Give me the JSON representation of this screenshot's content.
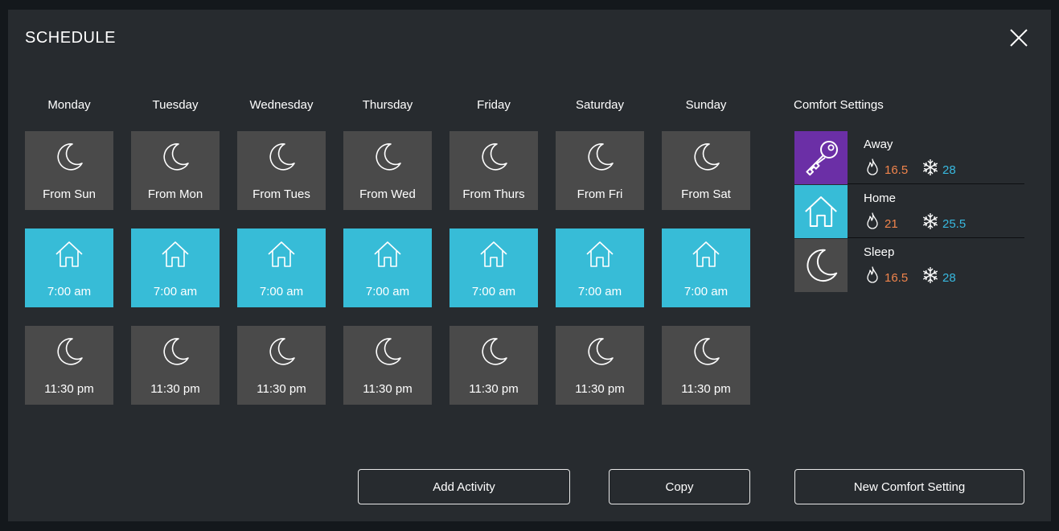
{
  "dialog": {
    "title": "SCHEDULE"
  },
  "days": [
    "Monday",
    "Tuesday",
    "Wednesday",
    "Thursday",
    "Friday",
    "Saturday",
    "Sunday"
  ],
  "schedule": {
    "row1": [
      "From Sun",
      "From Mon",
      "From Tues",
      "From Wed",
      "From Thurs",
      "From Fri",
      "From Sat"
    ],
    "row2": [
      "7:00 am",
      "7:00 am",
      "7:00 am",
      "7:00 am",
      "7:00 am",
      "7:00 am",
      "7:00 am"
    ],
    "row3": [
      "11:30 pm",
      "11:30 pm",
      "11:30 pm",
      "11:30 pm",
      "11:30 pm",
      "11:30 pm",
      "11:30 pm"
    ]
  },
  "row_icons": [
    "moon-icon",
    "house-icon",
    "moon-icon"
  ],
  "comfort": {
    "heading": "Comfort Settings",
    "items": [
      {
        "name": "Away",
        "heat": "16.5",
        "cool": "28",
        "icon": "key-icon",
        "color": "#6b2fa6"
      },
      {
        "name": "Home",
        "heat": "21",
        "cool": "25.5",
        "icon": "house-icon",
        "color": "#37bcd7"
      },
      {
        "name": "Sleep",
        "heat": "16.5",
        "cool": "28",
        "icon": "moon-icon",
        "color": "#4a4a4a"
      }
    ]
  },
  "buttons": {
    "add_activity": "Add Activity",
    "copy": "Copy",
    "new_comfort": "New Comfort Setting"
  },
  "colors": {
    "panel": "#272b2f",
    "sleep_tile": "#4a4a4a",
    "home_tile": "#37bcd7",
    "heat": "#f0844c",
    "cool": "#38b9e0"
  }
}
